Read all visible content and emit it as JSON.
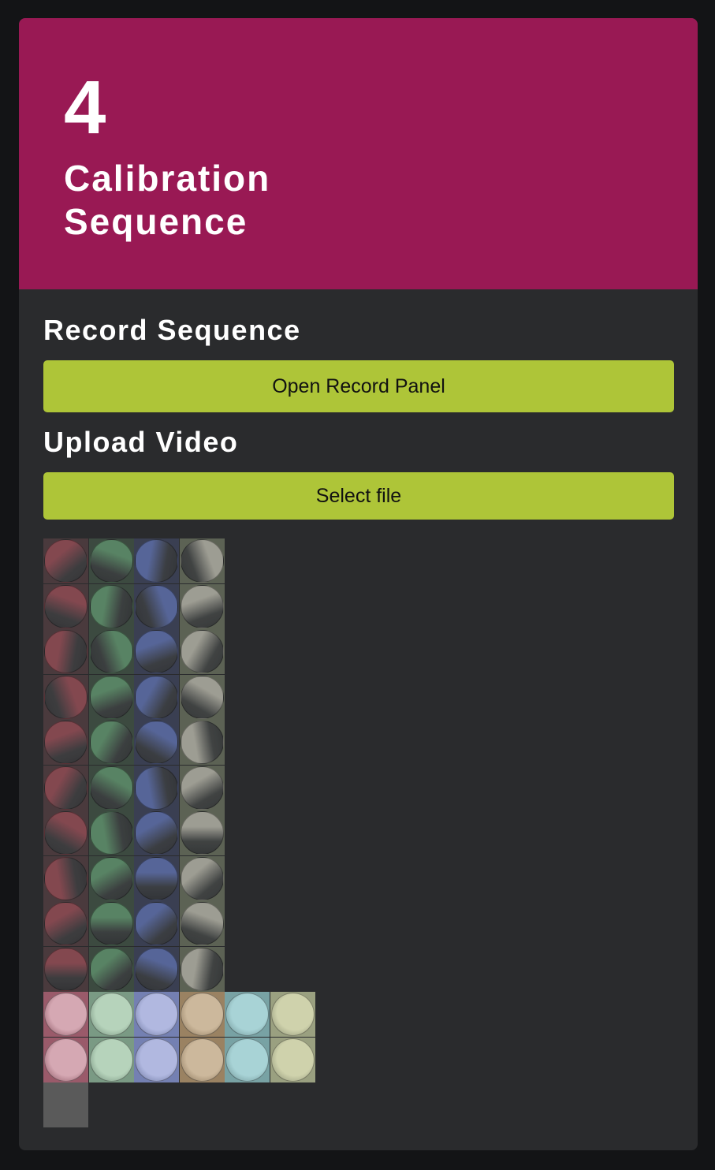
{
  "step": {
    "number": "4",
    "title_line1": "Calibration",
    "title_line2": "Sequence"
  },
  "record": {
    "heading": "Record Sequence",
    "button_label": "Open Record Panel"
  },
  "upload": {
    "heading": "Upload Video",
    "button_label": "Select file"
  },
  "colors": {
    "header_bg": "#991954",
    "accent_button": "#aec538",
    "card_bg": "#2a2b2d",
    "page_bg": "#131416"
  },
  "dark_frame_columns": [
    {
      "name": "red",
      "tint": "#8a4a52",
      "bg": "#4a3a3d"
    },
    {
      "name": "green",
      "tint": "#5c8a68",
      "bg": "#3c4a40"
    },
    {
      "name": "blue",
      "tint": "#5a6aa0",
      "bg": "#3a3f52"
    },
    {
      "name": "gray",
      "tint": "#a5a49a",
      "bg": "#5c6254"
    }
  ],
  "dark_frame_rows": 10,
  "light_frame_columns": [
    {
      "name": "pink",
      "tint": "#d5a8b3",
      "bg": "#9a5a6a"
    },
    {
      "name": "mint",
      "tint": "#b6d3bb",
      "bg": "#7a9a84"
    },
    {
      "name": "lavender",
      "tint": "#b1b8e0",
      "bg": "#7480b2"
    },
    {
      "name": "tan",
      "tint": "#ccb89c",
      "bg": "#9a8262"
    },
    {
      "name": "aqua",
      "tint": "#a8d3d6",
      "bg": "#78a2a4"
    },
    {
      "name": "cream",
      "tint": "#cfd2ac",
      "bg": "#9aa080"
    }
  ],
  "light_frame_rows": 2
}
